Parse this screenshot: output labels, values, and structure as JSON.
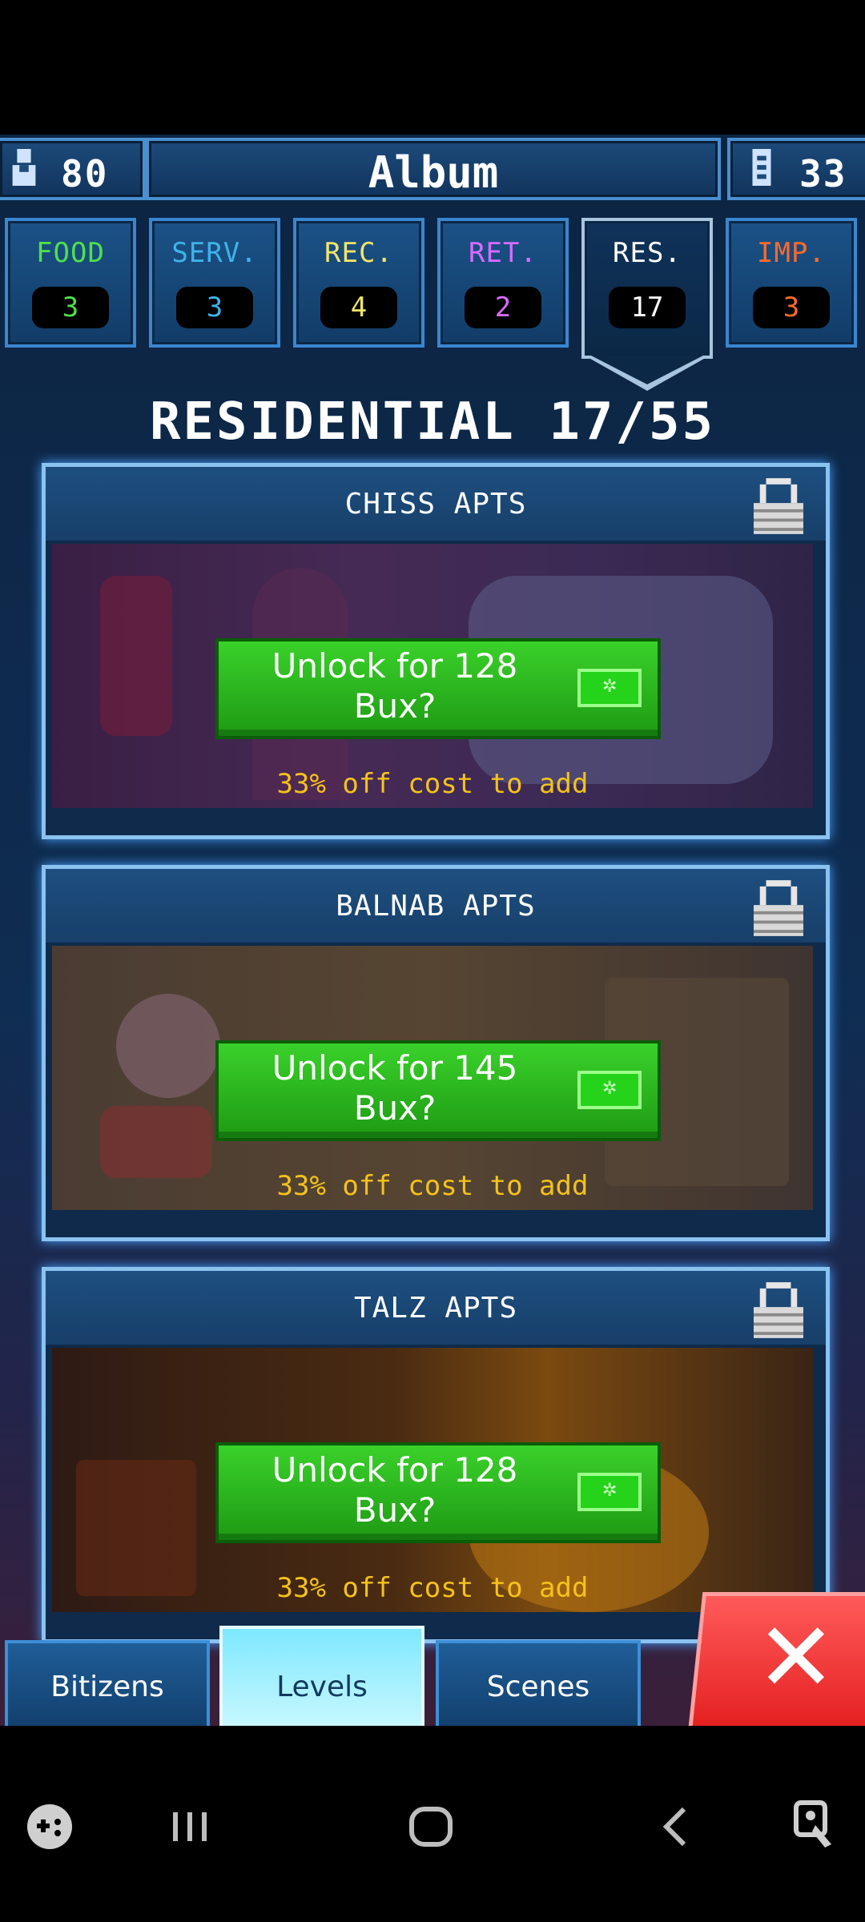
{
  "header": {
    "population": "80",
    "title": "Album",
    "floors": "33"
  },
  "categories": [
    {
      "label": "FOOD",
      "count": "3",
      "color": "#4fe04a"
    },
    {
      "label": "SERV.",
      "count": "3",
      "color": "#3fb3e8"
    },
    {
      "label": "REC.",
      "count": "4",
      "color": "#f1e46a"
    },
    {
      "label": "RET.",
      "count": "2",
      "color": "#d86bff"
    },
    {
      "label": "RES.",
      "count": "17",
      "color": "#ffffff",
      "active": true
    },
    {
      "label": "IMP.",
      "count": "3",
      "color": "#ff6a2a"
    }
  ],
  "section_title": "RESIDENTIAL 17/55",
  "cards": [
    {
      "name": "CHISS APTS",
      "unlock_line1": "Unlock for 128",
      "unlock_line2": "Bux?",
      "discount": "33% off cost to add"
    },
    {
      "name": "BALNAB APTS",
      "unlock_line1": "Unlock for 145",
      "unlock_line2": "Bux?",
      "discount": "33% off cost to add"
    },
    {
      "name": "TALZ APTS",
      "unlock_line1": "Unlock for 128",
      "unlock_line2": "Bux?",
      "discount": "33% off cost to add"
    }
  ],
  "bottom_tabs": [
    {
      "label": "Bitizens"
    },
    {
      "label": "Levels",
      "active": true
    },
    {
      "label": "Scenes"
    }
  ],
  "colors": {
    "accent": "#3a86cf",
    "unlock_green": "#2fb821",
    "discount_yellow": "#f4c21c",
    "close_red": "#e41f1f"
  },
  "icons": [
    "person-icon",
    "elevator-icon",
    "lock-icon",
    "bux-icon",
    "close-icon",
    "game-launcher-icon",
    "recents-icon",
    "home-icon",
    "back-icon",
    "accessibility-icon"
  ]
}
